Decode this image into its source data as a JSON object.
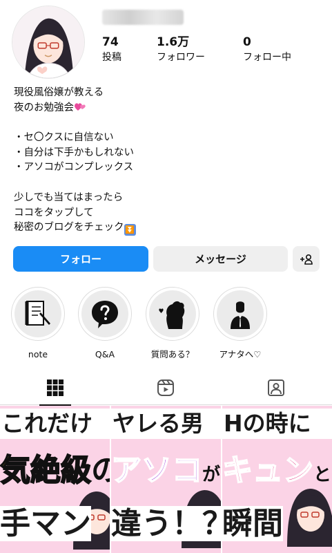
{
  "profile": {
    "stats": [
      {
        "value": "74",
        "label": "投稿"
      },
      {
        "value": "1.6万",
        "label": "フォロワー"
      },
      {
        "value": "0",
        "label": "フォロー中"
      }
    ],
    "bio_lines": [
      "現役風俗嬢が教える",
      "夜のお勉強会",
      "",
      "・セ〇クスに自信ない",
      "・自分は下手かもしれない",
      "・アソコがコンプレックス",
      "",
      "少しでも当てはまったら",
      "ココをタップして",
      "秘密のブログをチェック"
    ],
    "bio_emoji": {
      "heart": "💕",
      "down": "⏬"
    }
  },
  "actions": {
    "follow": "フォロー",
    "message": "メッセージ",
    "suggest_icon": "add-person-icon"
  },
  "highlights": [
    {
      "label": "note",
      "icon": "notebook-pen-icon"
    },
    {
      "label": "Q&A",
      "icon": "question-bubble-icon"
    },
    {
      "label": "質問ある？",
      "icon": "girl-silhouette-icon"
    },
    {
      "label": "アナタへ♡",
      "icon": "man-silhouette-icon"
    }
  ],
  "tabs": [
    {
      "name": "grid",
      "icon": "grid-icon",
      "active": true
    },
    {
      "name": "reels",
      "icon": "reels-icon",
      "active": false
    },
    {
      "name": "tagged",
      "icon": "tagged-icon",
      "active": false
    }
  ],
  "posts": [
    {
      "line1": "これだけ",
      "line2": "気絶級",
      "line2_tail": "の",
      "line3": "手マン"
    },
    {
      "line1": "ヤレる男",
      "line2": "アソコ",
      "line2_tail": "が",
      "line3": "違う！？"
    },
    {
      "line1": "Hの時に",
      "line2": "キュン",
      "line2_tail": "とし",
      "line3": "瞬間"
    }
  ],
  "colors": {
    "follow": "#1a8cf5",
    "post_bg": "#fbd3e6",
    "yellow": "#ffe633",
    "purple": "#9b3bd8",
    "magenta": "#e0297a"
  }
}
